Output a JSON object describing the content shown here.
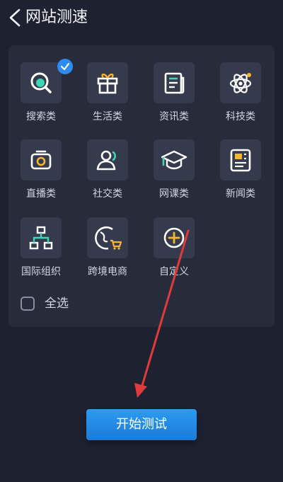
{
  "header": {
    "title": "网站测速"
  },
  "categories": [
    {
      "label": "搜索类",
      "icon": "search-icon",
      "checked": true
    },
    {
      "label": "生活类",
      "icon": "gift-icon"
    },
    {
      "label": "资讯类",
      "icon": "news-icon"
    },
    {
      "label": "科技类",
      "icon": "atom-icon"
    },
    {
      "label": "直播类",
      "icon": "camera-icon"
    },
    {
      "label": "社交类",
      "icon": "person-icon"
    },
    {
      "label": "网课类",
      "icon": "graduation-cap-icon"
    },
    {
      "label": "新闻类",
      "icon": "newspaper-icon"
    },
    {
      "label": "国际组织",
      "icon": "org-chart-icon"
    },
    {
      "label": "跨境电商",
      "icon": "globe-cart-icon"
    },
    {
      "label": "自定义",
      "icon": "add-icon"
    }
  ],
  "select_all": {
    "label": "全选",
    "checked": false
  },
  "start_button": {
    "label": "开始测试"
  },
  "colors": {
    "background": "#1e2130",
    "panel": "#272b3a",
    "tile": "#353a4c",
    "accent": "#2e8bf0",
    "highlight": "#3fd6b4",
    "annotation_arrow": "#e03a3a"
  }
}
